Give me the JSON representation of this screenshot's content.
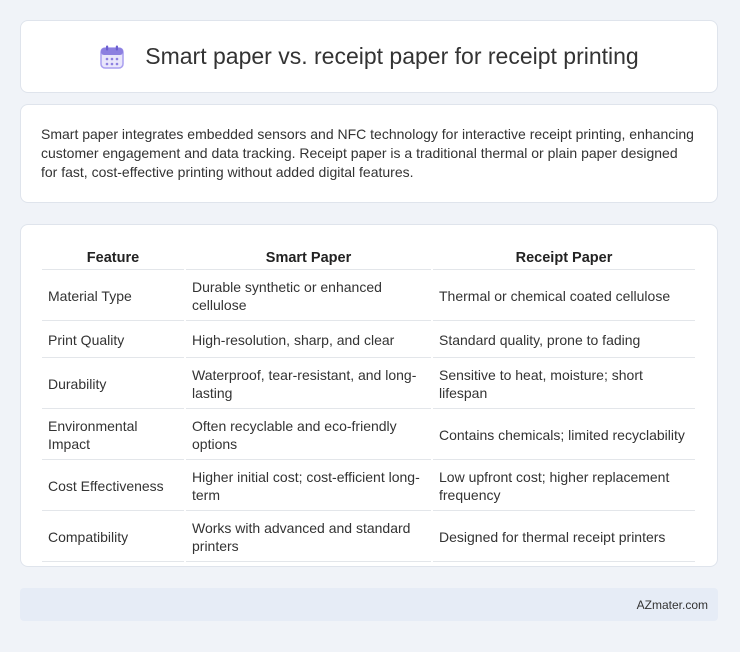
{
  "header": {
    "icon": "calendar-icon",
    "title": "Smart paper vs. receipt paper for receipt printing"
  },
  "intro": {
    "text": "Smart paper integrates embedded sensors and NFC technology for interactive receipt printing, enhancing customer engagement and data tracking. Receipt paper is a traditional thermal or plain paper designed for fast, cost-effective printing without added digital features."
  },
  "table": {
    "headers": [
      "Feature",
      "Smart Paper",
      "Receipt Paper"
    ],
    "rows": [
      [
        "Material Type",
        "Durable synthetic or enhanced cellulose",
        "Thermal or chemical coated cellulose"
      ],
      [
        "Print Quality",
        "High-resolution, sharp, and clear",
        "Standard quality, prone to fading"
      ],
      [
        "Durability",
        "Waterproof, tear-resistant, and long-lasting",
        "Sensitive to heat, moisture; short lifespan"
      ],
      [
        "Environmental Impact",
        "Often recyclable and eco-friendly options",
        "Contains chemicals; limited recyclability"
      ],
      [
        "Cost Effectiveness",
        "Higher initial cost; cost-efficient long-term",
        "Low upfront cost; higher replacement frequency"
      ],
      [
        "Compatibility",
        "Works with advanced and standard printers",
        "Designed for thermal receipt printers"
      ]
    ]
  },
  "footer": {
    "source": "AZmater.com"
  },
  "colors": {
    "background": "#f0f3f8",
    "card": "#ffffff",
    "footer_bg": "#e6ecf6",
    "icon_accent": "#8c7fe0"
  }
}
